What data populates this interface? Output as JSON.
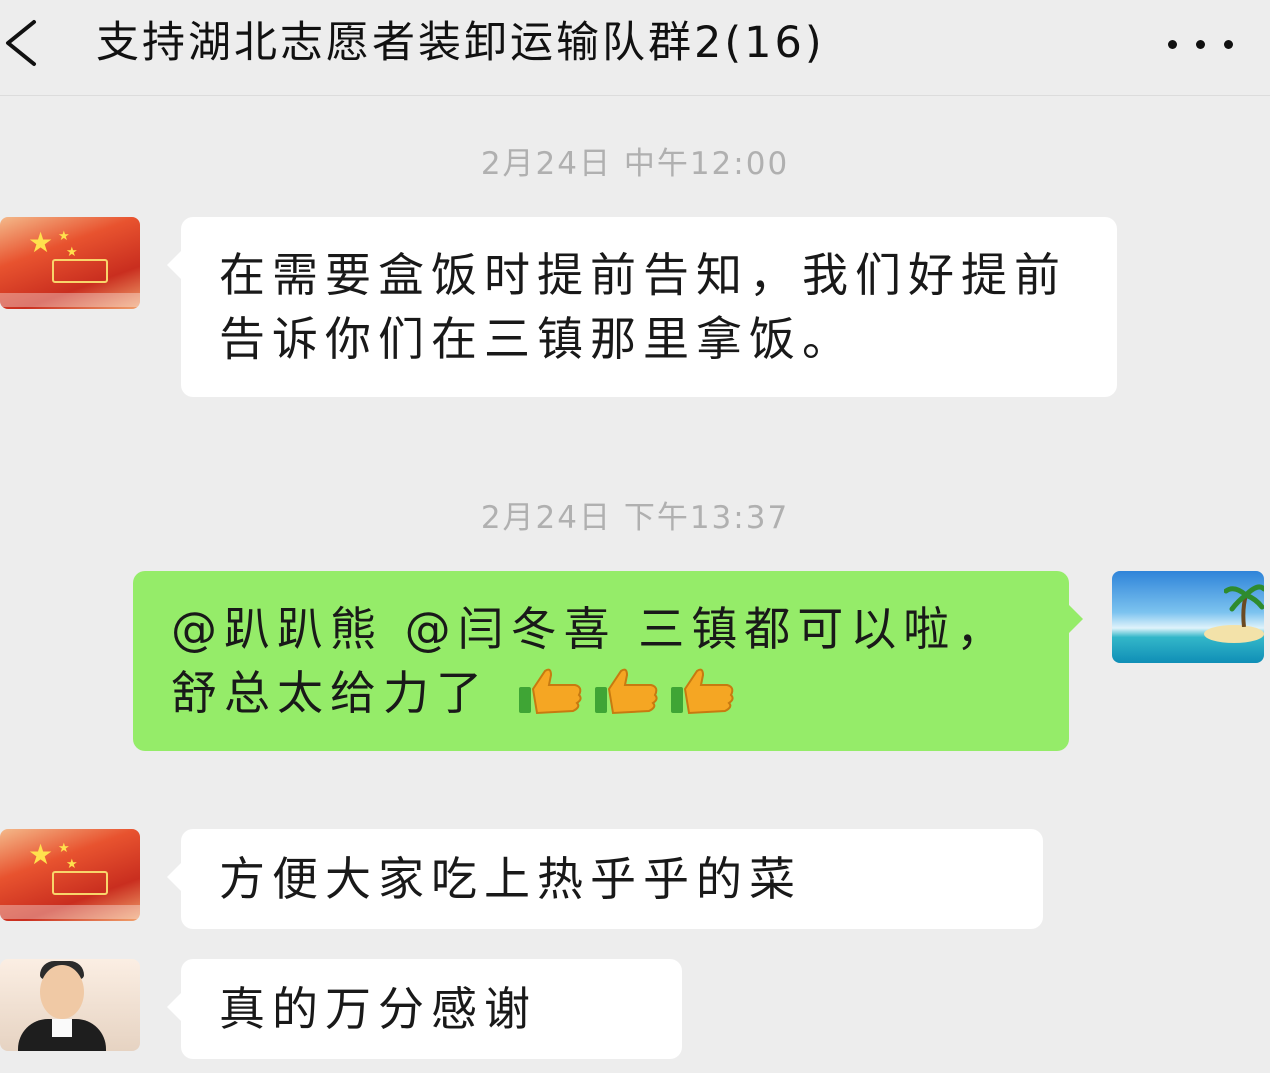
{
  "header": {
    "back_icon": "chevron-left-icon",
    "title": "支持湖北志愿者装卸运输队群2(16)",
    "more_icon": "more-dots-icon"
  },
  "messages": [
    {
      "type": "time",
      "text": "2月24日 中午12:00"
    },
    {
      "type": "message",
      "side": "left",
      "avatar": "flag-avatar",
      "text": "在需要盒饭时提前告知，我们好提前告诉你们在三镇那里拿饭。"
    },
    {
      "type": "time",
      "text": "2月24日 下午13:37"
    },
    {
      "type": "message",
      "side": "right",
      "avatar": "beach-avatar",
      "text": "@趴趴熊  @闫冬喜   三镇都可以啦，舒总太给力了",
      "emojis": [
        "thumbs-up-icon",
        "thumbs-up-icon",
        "thumbs-up-icon"
      ]
    },
    {
      "type": "message",
      "side": "left",
      "avatar": "flag-avatar",
      "text": "方便大家吃上热乎乎的菜"
    },
    {
      "type": "message",
      "side": "left",
      "avatar": "person-avatar",
      "text": "真的万分感谢"
    }
  ],
  "colors": {
    "background": "#ededed",
    "incoming_bubble": "#ffffff",
    "outgoing_bubble": "#95ec69",
    "timestamp": "#b0b0b0",
    "thumbs_up": "#f5a623"
  }
}
